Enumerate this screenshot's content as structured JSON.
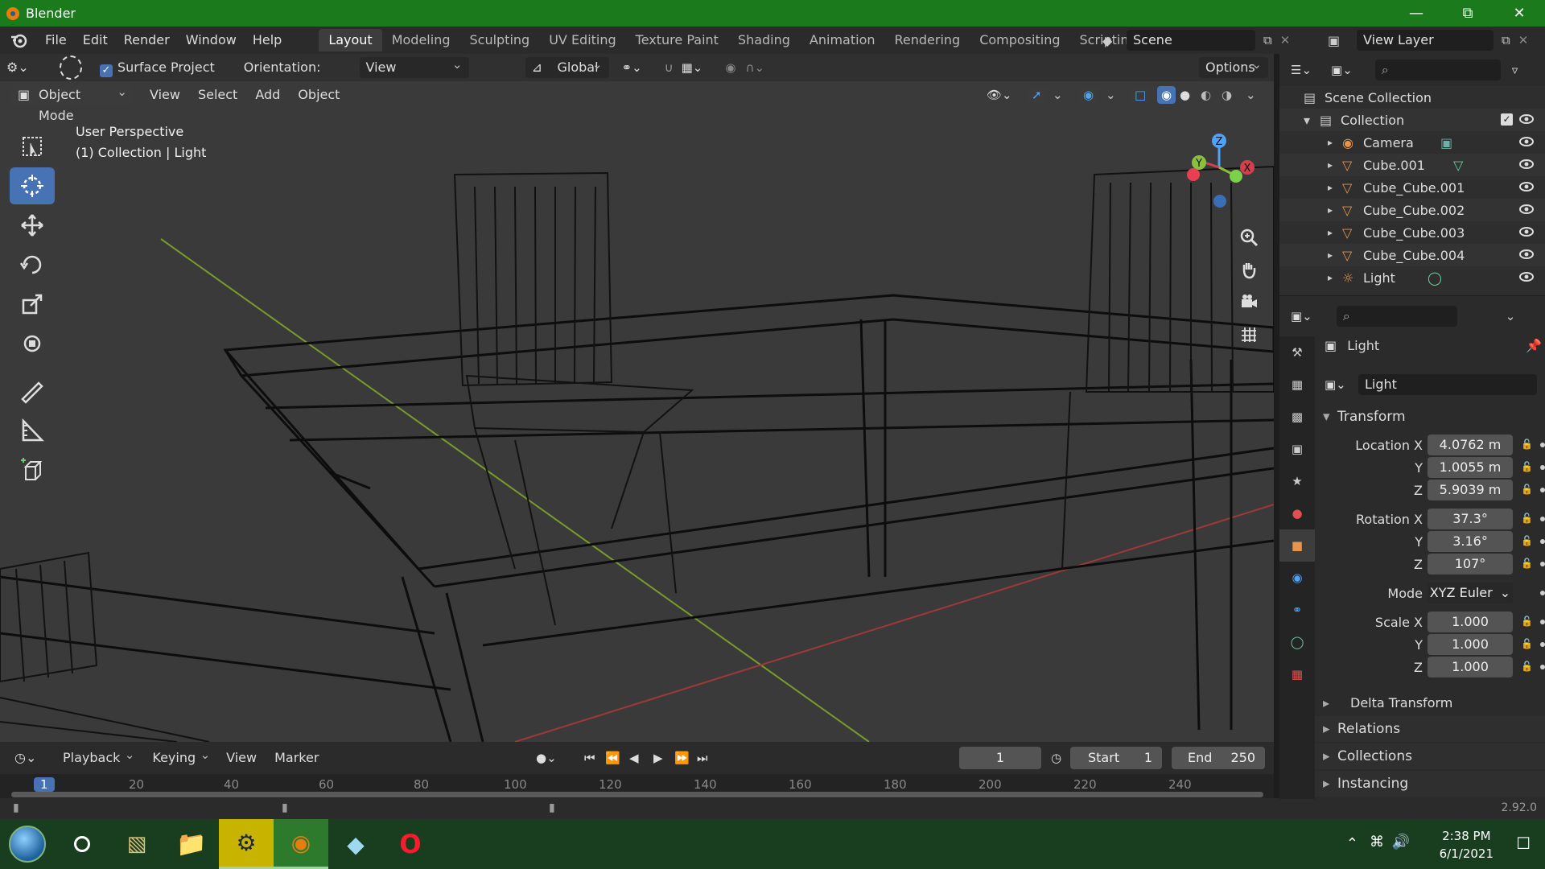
{
  "window": {
    "title": "Blender"
  },
  "menu": [
    "File",
    "Edit",
    "Render",
    "Window",
    "Help"
  ],
  "workspaces": [
    "Layout",
    "Modeling",
    "Sculpting",
    "UV Editing",
    "Texture Paint",
    "Shading",
    "Animation",
    "Rendering",
    "Compositing",
    "Scripting"
  ],
  "scene": {
    "name": "Scene",
    "view_layer": "View Layer"
  },
  "viewport": {
    "surface_project": "Surface Project",
    "orientation_label": "Orientation:",
    "orientation_value": "View",
    "transform_orientation": "Global",
    "options": "Options",
    "mode": "Object Mode",
    "menu": [
      "View",
      "Select",
      "Add",
      "Object"
    ],
    "info_line1": "User Perspective",
    "info_line2": "(1) Collection | Light",
    "gizmo": {
      "z": "Z",
      "y": "Y",
      "x": "X"
    }
  },
  "timeline": {
    "menus": [
      "Playback",
      "Keying",
      "View",
      "Marker"
    ],
    "current_frame": "1",
    "start_label": "Start",
    "start_value": "1",
    "end_label": "End",
    "end_value": "250",
    "ruler": [
      "1",
      "20",
      "40",
      "60",
      "80",
      "100",
      "120",
      "140",
      "160",
      "180",
      "200",
      "220",
      "240"
    ]
  },
  "status": {
    "version": "2.92.0"
  },
  "outliner": {
    "scene_collection": "Scene Collection",
    "collection": "Collection",
    "items": [
      "Camera",
      "Cube.001",
      "Cube_Cube.001",
      "Cube_Cube.002",
      "Cube_Cube.003",
      "Cube_Cube.004",
      "Light"
    ]
  },
  "properties": {
    "object_name": "Light",
    "data_name": "Light",
    "transform_label": "Transform",
    "location_label": "Location X",
    "location": [
      "4.0762 m",
      "1.0055 m",
      "5.9039 m"
    ],
    "rotation_label": "Rotation X",
    "rotation": [
      "37.3°",
      "3.16°",
      "107°"
    ],
    "mode_label": "Mode",
    "mode_value": "XYZ Euler",
    "scale_label": "Scale X",
    "scale": [
      "1.000",
      "1.000",
      "1.000"
    ],
    "axis_y": "Y",
    "axis_z": "Z",
    "delta_transform": "Delta Transform",
    "relations": "Relations",
    "collections": "Collections",
    "instancing": "Instancing"
  },
  "taskbar": {
    "time": "2:38 PM",
    "date": "6/1/2021"
  }
}
